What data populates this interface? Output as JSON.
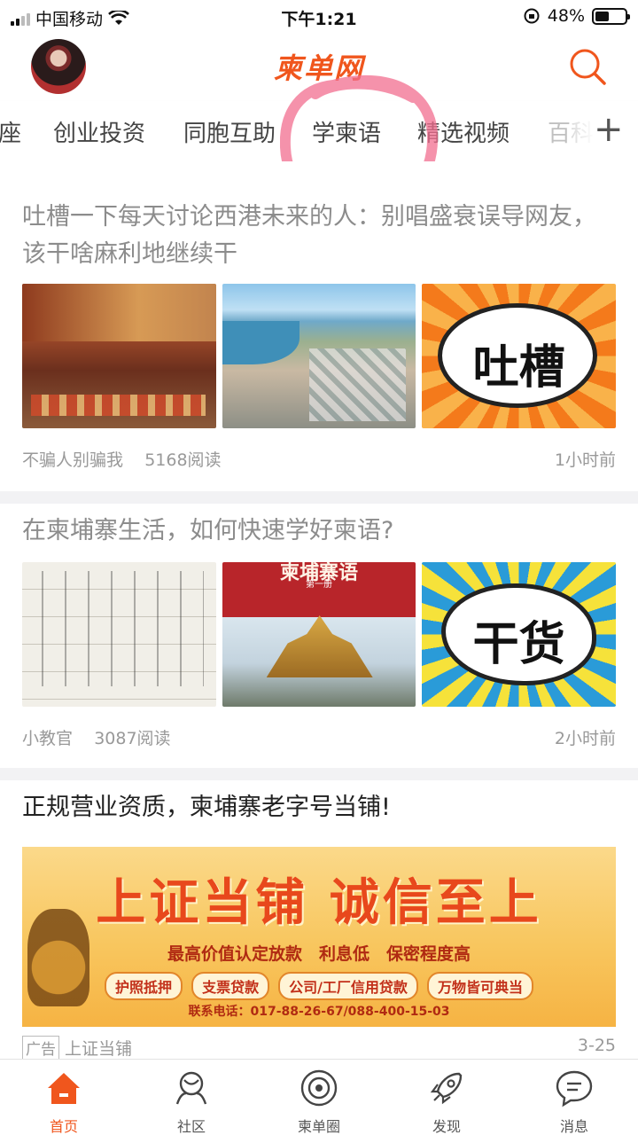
{
  "status_bar": {
    "carrier": "中国移动",
    "time": "下午1:21",
    "battery": "48%",
    "battery_level": 0.48
  },
  "header": {
    "logo": "柬单网",
    "avatar": "user-avatar",
    "search_icon": "search-icon"
  },
  "tabs": {
    "items": [
      "座",
      "创业投资",
      "同胞互助",
      "学柬语",
      "精选视频",
      "百科"
    ],
    "more_icon": "plus-icon"
  },
  "articles": [
    {
      "title": "吐槽一下每天讨论西港未来的人：别唱盛衰误导网友，该干啥麻利地继续干",
      "author": "不骗人别骗我",
      "reads": "5168阅读",
      "time": "1小时前",
      "thumb3_text": "吐槽"
    },
    {
      "title": "在柬埔寨生活，如何快速学好柬语?",
      "author": "小教官",
      "reads": "3087阅读",
      "time": "2小时前",
      "thumb2_caption": "柬埔寨语",
      "thumb2_sub": "第一册",
      "thumb3_text": "干货"
    }
  ],
  "ad": {
    "title": "正规营业资质，柬埔寨老字号当铺!",
    "banner_title": "上证当铺 诚信至上",
    "banner_sub": "最高价值认定放款　利息低　保密程度高",
    "pills": [
      "护照抵押",
      "支票贷款",
      "公司/工厂信用贷款",
      "万物皆可典当"
    ],
    "contact": "联系电话：017-88-26-67/088-400-15-03",
    "tag": "广告",
    "sponsor": "上证当铺",
    "date": "3-25"
  },
  "bottom_nav": [
    {
      "label": "首页",
      "icon": "home-icon",
      "active": true
    },
    {
      "label": "社区",
      "icon": "community-icon"
    },
    {
      "label": "柬单圈",
      "icon": "circle-icon"
    },
    {
      "label": "发现",
      "icon": "rocket-icon"
    },
    {
      "label": "消息",
      "icon": "message-icon"
    }
  ],
  "colors": {
    "brand": "#f0561d",
    "read_title": "#8c8c8c",
    "meta": "#999999"
  }
}
